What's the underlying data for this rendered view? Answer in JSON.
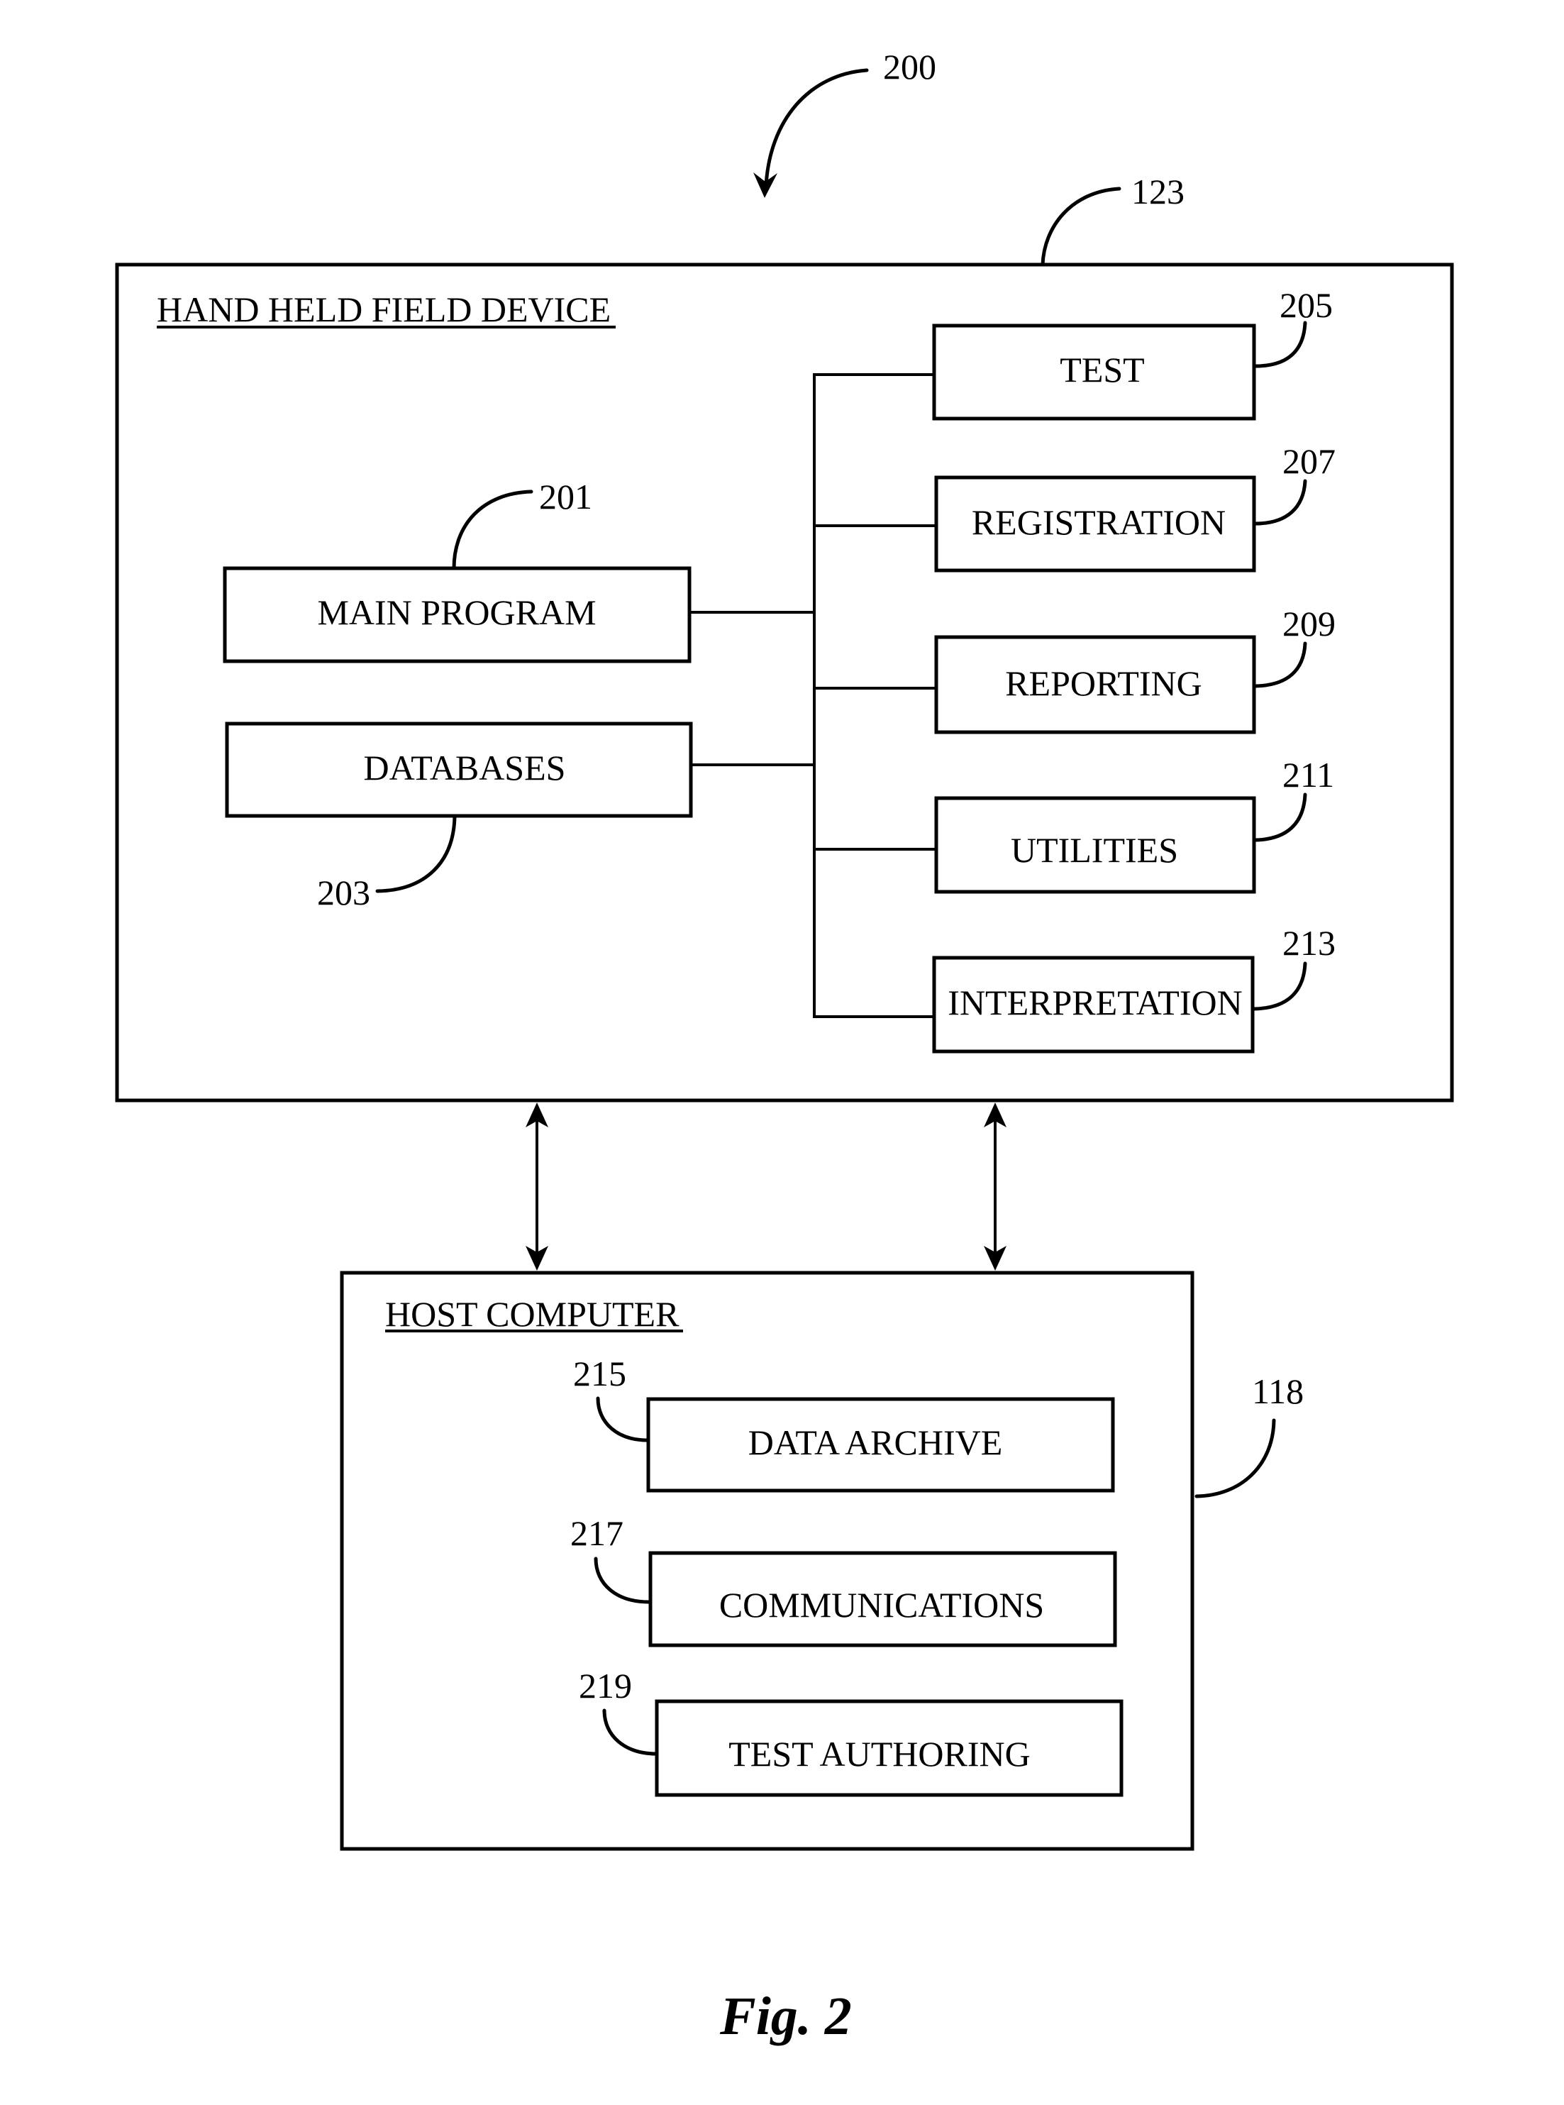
{
  "figure": {
    "caption": "Fig. 2",
    "reference": "200"
  },
  "hand_held_device": {
    "title": "HAND HELD FIELD DEVICE",
    "reference": "123",
    "main_program": {
      "label": "MAIN PROGRAM",
      "reference": "201"
    },
    "databases": {
      "label": "DATABASES",
      "reference": "203"
    },
    "modules": [
      {
        "label": "TEST",
        "reference": "205"
      },
      {
        "label": "REGISTRATION",
        "reference": "207"
      },
      {
        "label": "REPORTING",
        "reference": "209"
      },
      {
        "label": "UTILITIES",
        "reference": "211"
      },
      {
        "label": "INTERPRETATION",
        "reference": "213"
      }
    ]
  },
  "host_computer": {
    "title": "HOST COMPUTER",
    "reference": "118",
    "modules": [
      {
        "label": "DATA ARCHIVE",
        "reference": "215"
      },
      {
        "label": "COMMUNICATIONS",
        "reference": "217"
      },
      {
        "label": "TEST AUTHORING",
        "reference": "219"
      }
    ]
  },
  "connections": [
    {
      "from": "HAND HELD FIELD DEVICE",
      "to": "HOST COMPUTER",
      "direction": "bidirectional"
    },
    {
      "from": "HAND HELD FIELD DEVICE",
      "to": "HOST COMPUTER",
      "direction": "bidirectional"
    }
  ]
}
